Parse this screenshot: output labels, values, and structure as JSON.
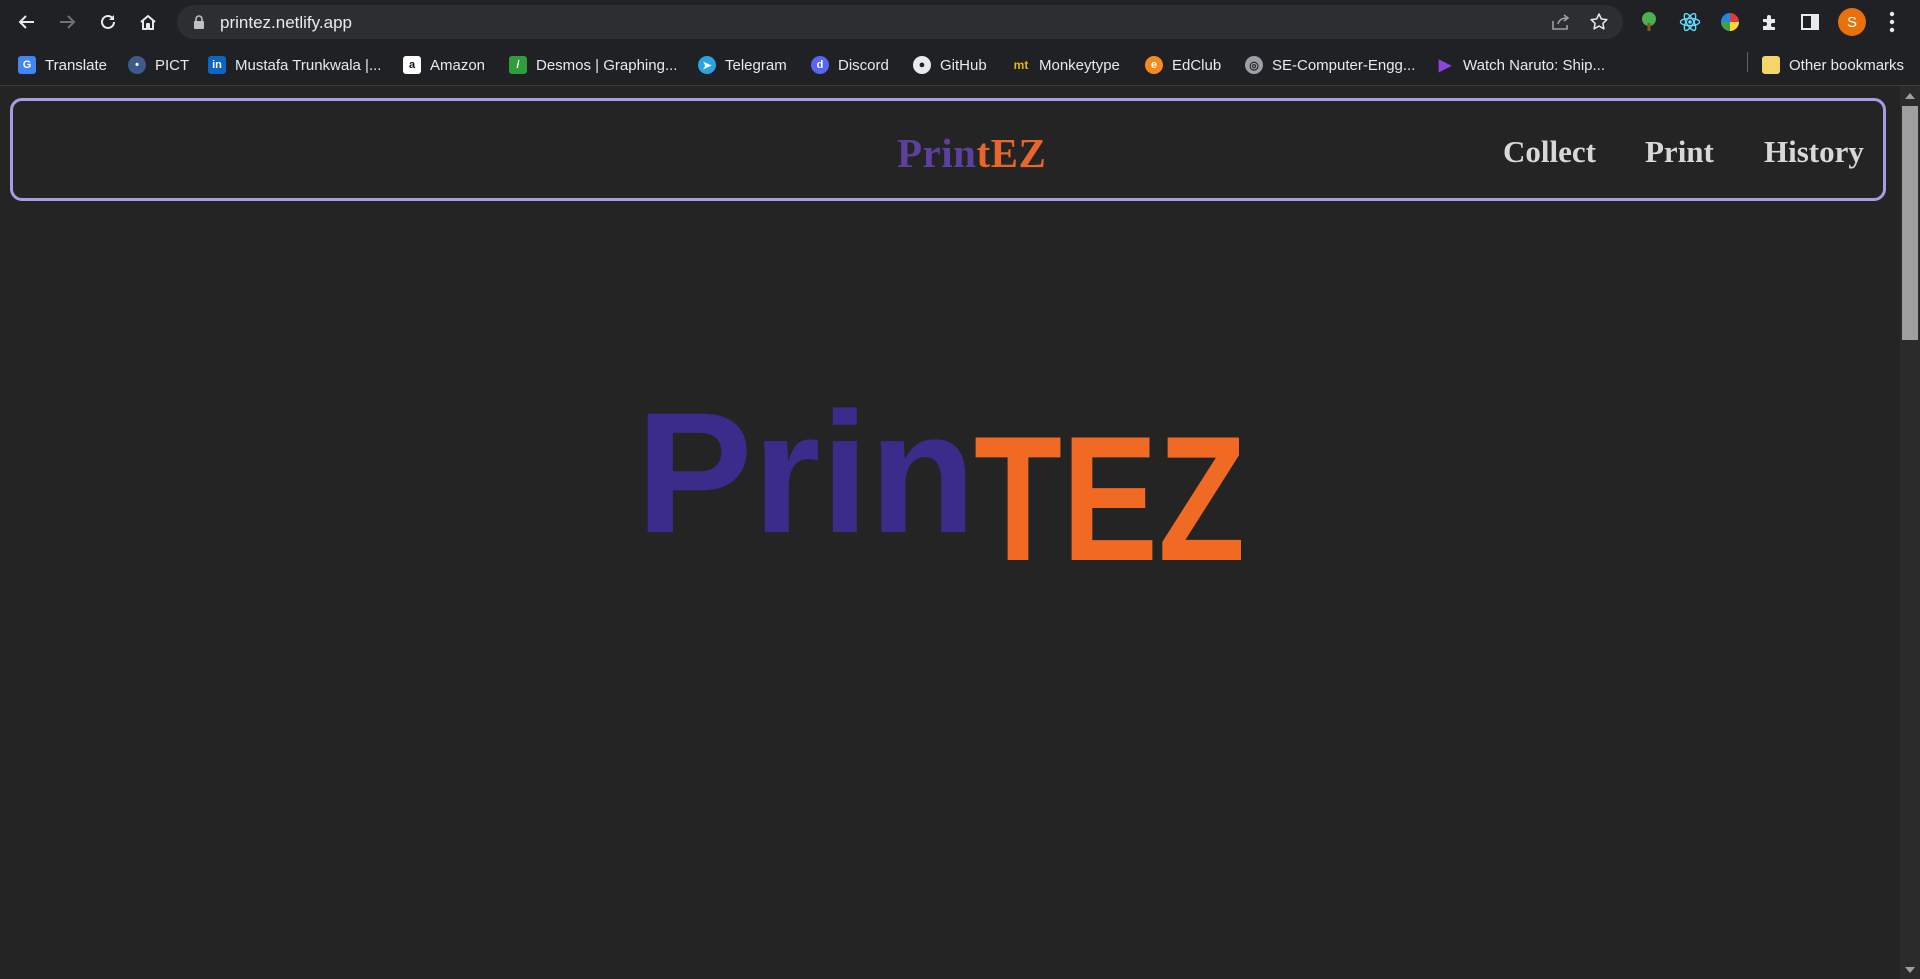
{
  "browser": {
    "url": "printez.netlify.app",
    "profile_initial": "S",
    "bookmarks": [
      {
        "label": "Translate",
        "icon": "google-translate-icon",
        "color": "#4285f4"
      },
      {
        "label": "PICT",
        "icon": "pict-icon",
        "color": "#3c5a8a"
      },
      {
        "label": "Mustafa Trunkwala |...",
        "icon": "linkedin-icon",
        "color": "#0a66c2"
      },
      {
        "label": "Amazon",
        "icon": "amazon-icon",
        "color": "#ffffff"
      },
      {
        "label": "Desmos | Graphing...",
        "icon": "desmos-icon",
        "color": "#2f9d3c"
      },
      {
        "label": "Telegram",
        "icon": "telegram-icon",
        "color": "#2aa3e0"
      },
      {
        "label": "Discord",
        "icon": "discord-icon",
        "color": "#5865f2"
      },
      {
        "label": "GitHub",
        "icon": "github-icon",
        "color": "#e8eaed"
      },
      {
        "label": "Monkeytype",
        "icon": "monkeytype-icon",
        "color": "#e2b714"
      },
      {
        "label": "EdClub",
        "icon": "edclub-icon",
        "color": "#f58a1f"
      },
      {
        "label": "SE-Computer-Engg...",
        "icon": "globe-icon",
        "color": "#9aa0a6"
      },
      {
        "label": "Watch Naruto: Ship...",
        "icon": "play-icon",
        "color": "#8e44e0"
      }
    ],
    "other_bookmarks": "Other bookmarks"
  },
  "navbar": {
    "brand_part1": "Prin",
    "brand_part2": "tEZ",
    "links": [
      "Collect",
      "Print",
      "History"
    ]
  },
  "hero_logo": {
    "part1": "Prin",
    "part2": "TEZ",
    "color_purple": "#3b2b8a",
    "color_orange": "#f06a24"
  },
  "colors": {
    "brand_purple": "#5d3f9e",
    "brand_orange": "#e8652b",
    "navbar_border": "#a99be6",
    "page_bg": "#242424"
  }
}
